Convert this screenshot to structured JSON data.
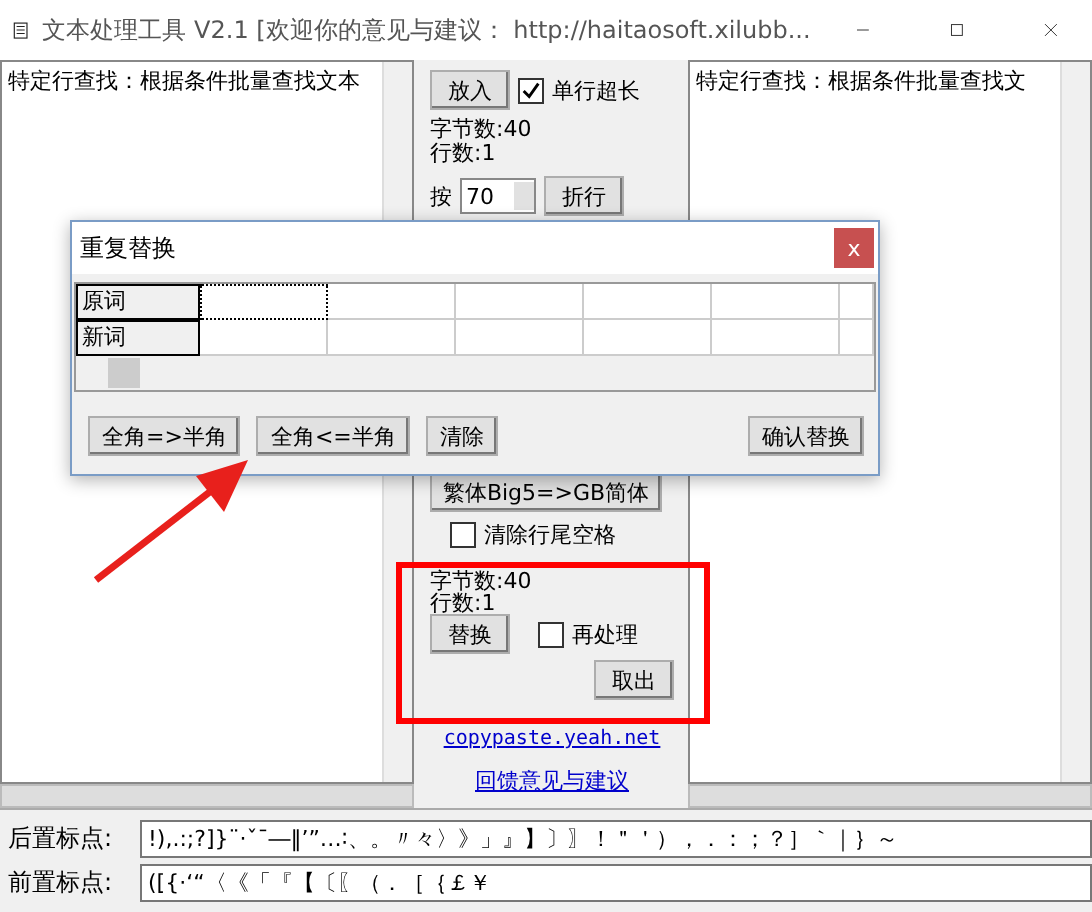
{
  "window": {
    "title": "文本处理工具 V2.1 [欢迎你的意见与建议：  http://haitaosoft.xilubb..."
  },
  "left_text": {
    "value": "特定行查找：根据条件批量查找文本"
  },
  "middle_top": {
    "put_button": "放入",
    "single_line_long": {
      "label": "单行超长",
      "checked": true
    },
    "byte_count": "字节数:40",
    "line_count": "行数:1",
    "wrap_by": {
      "label": "按",
      "value": "70",
      "button": "折行"
    }
  },
  "middle_bottom": {
    "convert_button": "繁体Big5=>GB简体",
    "trim_trailing": {
      "label": "清除行尾空格",
      "checked": false
    },
    "byte_count": "字节数:40",
    "line_count": "行数:1",
    "replace_button": "替换",
    "reprocess": {
      "label": "再处理",
      "checked": false
    },
    "take_out_button": "取出",
    "links": [
      "copypaste.yeah.net",
      "回馈意见与建议"
    ]
  },
  "right_text": {
    "value": "特定行查找：根据条件批量查找文"
  },
  "punctuation": [
    {
      "label": "后置标点:",
      "value": "!),.:;?]}¨·ˇˉ―‖’”…∶、。〃々〉》」』】〕〗！＂＇），．：；？］｀｜｝～"
    },
    {
      "label": "前置标点:",
      "value": "([{·‘“〈《「『【〔〖（．［｛￡￥"
    }
  ],
  "dialog": {
    "title": "重复替换",
    "close": "x",
    "row_headers": [
      "原词",
      "新词"
    ],
    "buttons": [
      "全角=>半角",
      "全角<=半角",
      "清除",
      "确认替换"
    ]
  }
}
